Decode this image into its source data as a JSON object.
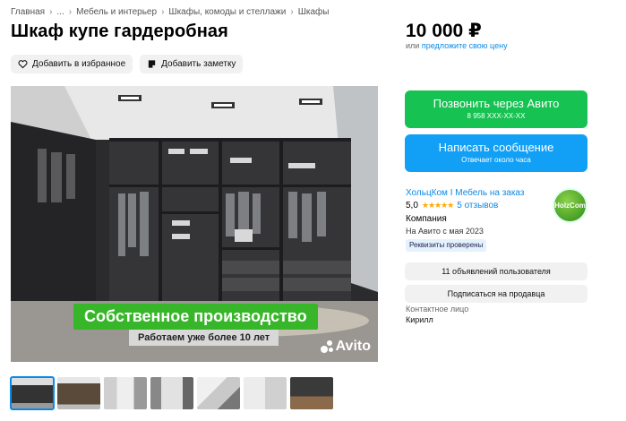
{
  "breadcrumbs": [
    "Главная",
    "...",
    "Мебель и интерьер",
    "Шкафы, комоды и стеллажи",
    "Шкафы"
  ],
  "title": "Шкаф купе гардеробная",
  "actions": {
    "favorite": "Добавить в избранное",
    "note": "Добавить заметку"
  },
  "photo": {
    "banner_main": "Собственное производство",
    "banner_sub": "Работаем уже более 10 лет",
    "watermark": "Avito"
  },
  "price": {
    "value": "10 000 ₽",
    "prefix": "или",
    "link": "предложите свою цену"
  },
  "call_button": {
    "label": "Позвонить через Авито",
    "phone": "8 958 XXX-XX-XX"
  },
  "message_button": {
    "label": "Написать сообщение",
    "sub": "Отвечает около часа"
  },
  "seller": {
    "name": "ХольцКом I Мебель на заказ",
    "rating": "5,0",
    "stars": "★★★★★",
    "reviews": "5 отзывов",
    "type": "Компания",
    "since": "На Авито с мая 2023",
    "verified": "Реквизиты проверены",
    "logo_text": "HolzCom"
  },
  "listings_button": "11 объявлений пользователя",
  "subscribe_button": "Подписаться на продавца",
  "contact": {
    "label": "Контактное лицо",
    "name": "Кирилл"
  },
  "colors": {
    "accent_blue": "#11a0f5",
    "call_green": "#16c251",
    "banner_green": "#38b629"
  }
}
